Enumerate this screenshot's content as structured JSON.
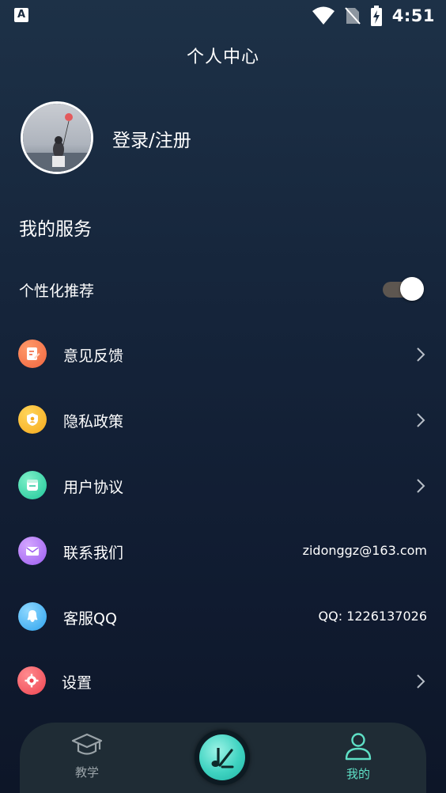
{
  "status_bar": {
    "notification_icon": "A",
    "time": "4:51",
    "icons": [
      "wifi-icon",
      "no-sim-icon",
      "battery-charging-icon"
    ]
  },
  "header": {
    "title": "个人中心"
  },
  "profile": {
    "login_text": "登录/注册",
    "avatar": "avatar-photo"
  },
  "services": {
    "title": "我的服务",
    "personalized": {
      "label": "个性化推荐",
      "enabled": true
    },
    "items": [
      {
        "label": "意见反馈",
        "icon": "feedback-icon",
        "color": "#f0653f",
        "trailing": "chevron"
      },
      {
        "label": "隐私政策",
        "icon": "privacy-icon",
        "color": "#f6b21c",
        "trailing": "chevron"
      },
      {
        "label": "用户协议",
        "icon": "agreement-icon",
        "color": "#27d3a5",
        "trailing": "chevron"
      },
      {
        "label": "联系我们",
        "icon": "mail-icon",
        "color": "#a86cf2",
        "trailing": "value",
        "value": "zidonggz@163.com"
      },
      {
        "label": "客服QQ",
        "icon": "qq-icon",
        "color": "#3fb3f5",
        "trailing": "value",
        "value": "QQ: 1226137026"
      },
      {
        "label": "设置",
        "icon": "gear-icon",
        "color": "#f2515b",
        "trailing": "chevron"
      }
    ]
  },
  "bottom_nav": {
    "items": [
      {
        "label": "教学",
        "icon": "graduation-cap-icon",
        "active": false
      },
      {
        "label": "我的",
        "icon": "user-icon",
        "active": true
      }
    ],
    "center_icon": "music-note-icon",
    "active_color": "#5fe0c6",
    "inactive_color": "#9aa3a8"
  }
}
